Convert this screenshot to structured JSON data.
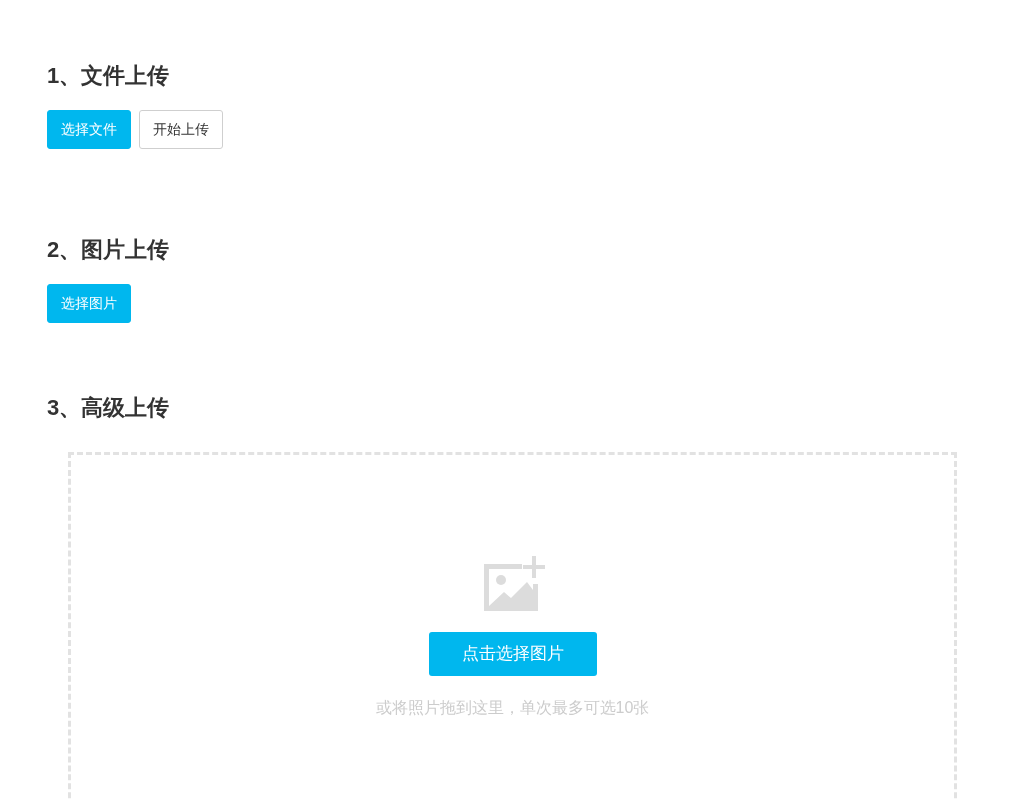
{
  "sections": [
    {
      "title": "1、文件上传",
      "kind": "buttons",
      "buttons": [
        {
          "label": "选择文件",
          "kind": "primary"
        },
        {
          "label": "开始上传",
          "kind": "default"
        }
      ]
    },
    {
      "title": "2、图片上传",
      "kind": "buttons",
      "buttons": [
        {
          "label": "选择图片",
          "kind": "primary"
        }
      ]
    },
    {
      "title": "3、高级上传",
      "kind": "dropzone",
      "button": "点击选择图片",
      "hint": "或将照片拖到这里，单次最多可选10张"
    }
  ]
}
